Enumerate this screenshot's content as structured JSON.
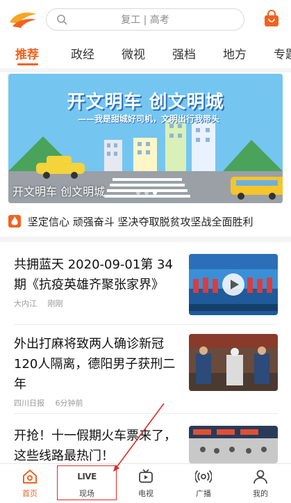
{
  "header": {
    "search_placeholder": "复工 | 高考",
    "logo_icon": "app-logo",
    "search_icon": "search-icon",
    "cart_icon": "shopping-bag-icon"
  },
  "tabs": [
    {
      "label": "推荐",
      "active": true
    },
    {
      "label": "政经"
    },
    {
      "label": "微视"
    },
    {
      "label": "强档"
    },
    {
      "label": "地方"
    },
    {
      "label": "专题"
    }
  ],
  "banner": {
    "title": "开文明车 创文明城",
    "subtitle": "——我是甜城好司机，文明出行我带头",
    "caption": "开文明车 创文明城",
    "dots": 3,
    "active_dot": 2
  },
  "ticker": {
    "icon": "fire-icon",
    "text": "坚定信心 顽强奋斗 坚决夺取脱贫攻坚战全面胜利"
  },
  "news": [
    {
      "title": "共拥蓝天 2020-09-01第 34 期《抗疫英雄齐聚张家界》",
      "source": "大内江",
      "time": "刚刚",
      "has_video": true
    },
    {
      "title": "外出打麻将致两人确诊新冠 120人隔离，德阳男子获刑二年",
      "source": "四川日报",
      "time": "6分钟前"
    },
    {
      "title": "开抢！十一假期火车票来了，这些线路最热门！",
      "source": "",
      "time": ""
    }
  ],
  "bottom_nav": [
    {
      "label": "首页",
      "icon": "home-icon",
      "active": true
    },
    {
      "label": "现场",
      "icon": "live-icon",
      "icon_text": "LIVE"
    },
    {
      "label": "电视",
      "icon": "tv-icon"
    },
    {
      "label": "广播",
      "icon": "broadcast-icon"
    },
    {
      "label": "我的",
      "icon": "profile-icon"
    }
  ],
  "colors": {
    "accent": "#f2621f",
    "annotation": "#e02a2a"
  }
}
